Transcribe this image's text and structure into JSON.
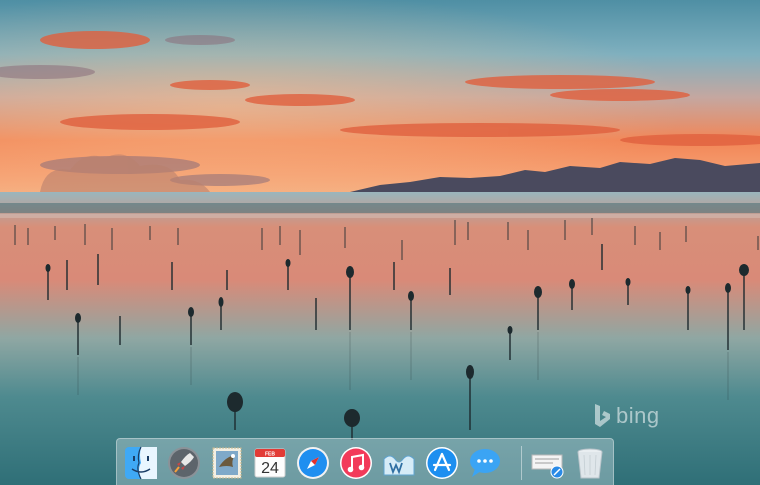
{
  "watermark": {
    "text": "bing",
    "icon": "bing-logo-icon"
  },
  "dock": {
    "items": [
      {
        "name": "finder",
        "icon": "finder-icon"
      },
      {
        "name": "launchpad",
        "icon": "rocket-icon"
      },
      {
        "name": "mail",
        "icon": "stamp-eagle-icon"
      },
      {
        "name": "calendar",
        "icon": "calendar-icon",
        "month": "FEB",
        "day": "24"
      },
      {
        "name": "safari",
        "icon": "compass-icon"
      },
      {
        "name": "itunes",
        "icon": "music-note-icon"
      },
      {
        "name": "wunderlist",
        "icon": "wave-w-icon"
      },
      {
        "name": "app-store",
        "icon": "app-store-a-icon"
      },
      {
        "name": "messages",
        "icon": "speech-bubble-icon"
      },
      {
        "name": "applications-stack",
        "icon": "stack-folder-icon"
      },
      {
        "name": "trash",
        "icon": "trash-icon"
      }
    ]
  },
  "colors": {
    "sky_top": "#5f9fb2",
    "sunset_orange": "#f07a4e",
    "water": "#3f7f86",
    "dock_bg": "#d2e1e8"
  }
}
